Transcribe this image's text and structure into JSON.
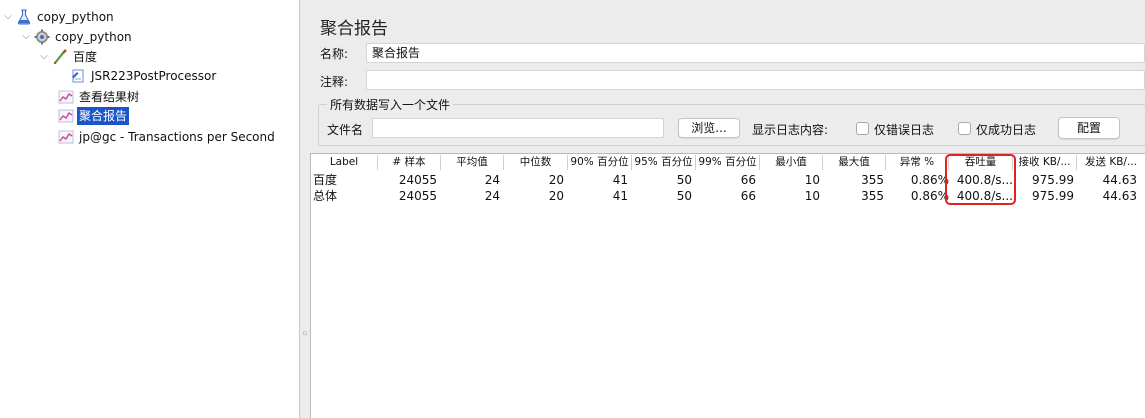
{
  "tree": {
    "items": [
      {
        "label": "copy_python",
        "icon": "flask-icon"
      },
      {
        "label": "copy_python",
        "icon": "gear-icon"
      },
      {
        "label": "百度",
        "icon": "pipette-icon"
      },
      {
        "label": "JSR223PostProcessor",
        "icon": "script-icon"
      },
      {
        "label": "查看结果树",
        "icon": "graph-icon"
      },
      {
        "label": "聚合报告",
        "icon": "graph-icon",
        "selected": true
      },
      {
        "label": "jp@gc - Transactions per Second",
        "icon": "graph-icon"
      }
    ]
  },
  "panel": {
    "title": "聚合报告",
    "name_label": "名称:",
    "name_value": "聚合报告",
    "comment_label": "注释:",
    "comment_value": "",
    "group_title": "所有数据写入一个文件",
    "file_label": "文件名",
    "file_value": "",
    "browse_button": "浏览...",
    "log_label": "显示日志内容:",
    "errors_only": "仅错误日志",
    "success_only": "仅成功日志",
    "configure_button": "配置"
  },
  "table": {
    "headers": [
      "Label",
      "# 样本",
      "平均值",
      "中位数",
      "90% 百分位",
      "95% 百分位",
      "99% 百分位",
      "最小值",
      "最大值",
      "异常 %",
      "吞吐量",
      "接收 KB/...",
      "发送 KB/..."
    ],
    "rows": [
      [
        "百度",
        "24055",
        "24",
        "20",
        "41",
        "50",
        "66",
        "10",
        "355",
        "0.86%",
        "400.8/s...",
        "975.99",
        "44.63"
      ],
      [
        "总体",
        "24055",
        "24",
        "20",
        "41",
        "50",
        "66",
        "10",
        "355",
        "0.86%",
        "400.8/s...",
        "975.99",
        "44.63"
      ]
    ],
    "highlight_color": "#e0211d"
  },
  "colors": {
    "selection": "#1a54c9"
  }
}
